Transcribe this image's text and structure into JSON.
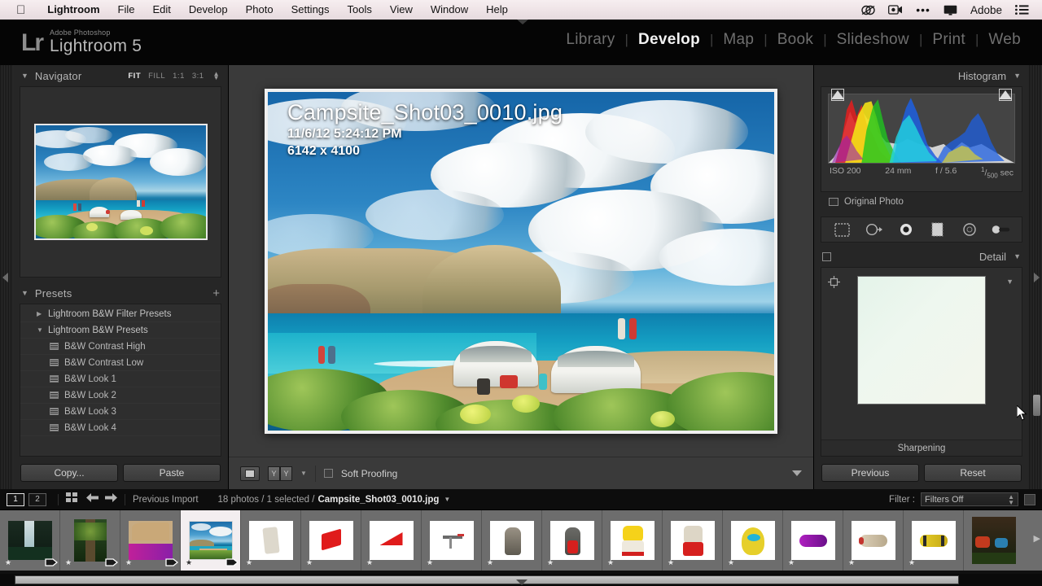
{
  "macmenu": {
    "apple": "apple-logo",
    "items": [
      "Lightroom",
      "File",
      "Edit",
      "Develop",
      "Photo",
      "Settings",
      "Tools",
      "View",
      "Window",
      "Help"
    ],
    "right": {
      "cc_icon": "creative-cloud-icon",
      "rec_icon": "screen-record-icon",
      "dots": "•••",
      "display_icon": "display-icon",
      "label": "Adobe",
      "list_icon": "list-icon"
    }
  },
  "identity": {
    "mark": "Lr",
    "line1": "Adobe Photoshop",
    "line2": "Lightroom 5"
  },
  "modules": [
    {
      "label": "Library",
      "active": false
    },
    {
      "label": "Develop",
      "active": true
    },
    {
      "label": "Map",
      "active": false
    },
    {
      "label": "Book",
      "active": false
    },
    {
      "label": "Slideshow",
      "active": false
    },
    {
      "label": "Print",
      "active": false
    },
    {
      "label": "Web",
      "active": false
    }
  ],
  "navigator": {
    "title": "Navigator",
    "zoom_levels": [
      "FIT",
      "FILL",
      "1:1",
      "3:1"
    ],
    "active_zoom": "FIT"
  },
  "presets": {
    "title": "Presets",
    "add_label": "+",
    "items": [
      {
        "label": "Lightroom B&W Filter Presets",
        "type": "group",
        "expanded": false
      },
      {
        "label": "Lightroom B&W Presets",
        "type": "group",
        "expanded": true
      },
      {
        "label": "B&W Contrast High",
        "type": "preset"
      },
      {
        "label": "B&W Contrast Low",
        "type": "preset"
      },
      {
        "label": "B&W Look 1",
        "type": "preset"
      },
      {
        "label": "B&W Look 2",
        "type": "preset"
      },
      {
        "label": "B&W Look 3",
        "type": "preset"
      },
      {
        "label": "B&W Look 4",
        "type": "preset"
      }
    ]
  },
  "left_buttons": {
    "copy": "Copy...",
    "paste": "Paste"
  },
  "photo_overlay": {
    "filename": "Campsite_Shot03_0010.jpg",
    "datetime": "11/6/12 5:24:12 PM",
    "dimensions": "6142 x 4100"
  },
  "center_toolbar": {
    "loupe_icon": "loupe-view-icon",
    "before_after_left": "Y",
    "before_after_right": "Y",
    "soft_proofing_label": "Soft Proofing",
    "soft_proofing_checked": false,
    "dropdown_icon": "chevron-down-icon"
  },
  "histogram": {
    "title": "Histogram",
    "exif": {
      "iso": "ISO 200",
      "focal": "24 mm",
      "aperture": "f / 5.6",
      "shutter_num": "1",
      "shutter_den": "500",
      "shutter_unit": "sec"
    },
    "original_photo_label": "Original Photo",
    "original_photo_checked": false
  },
  "tools": [
    {
      "name": "crop-overlay-icon"
    },
    {
      "name": "spot-removal-icon"
    },
    {
      "name": "red-eye-correction-icon"
    },
    {
      "name": "graduated-filter-icon"
    },
    {
      "name": "radial-filter-icon"
    },
    {
      "name": "adjustment-brush-icon"
    }
  ],
  "detail": {
    "title": "Detail",
    "target_icon": "target-adjust-icon",
    "collapse_icon": "chevron-down-icon",
    "sharpening_label": "Sharpening"
  },
  "right_buttons": {
    "previous": "Previous",
    "reset": "Reset"
  },
  "filmstrip_bar": {
    "source1": "1",
    "source2": "2",
    "grid_icon": "grid-view-icon",
    "back_icon": "arrow-left-icon",
    "forward_icon": "arrow-right-icon",
    "source_label": "Previous Import",
    "count_label": "18 photos / 1 selected /",
    "selected_file": "Campsite_Shot03_0010.jpg",
    "file_dropdown_icon": "chevron-down-icon",
    "filter_label": "Filter :",
    "filter_value": "Filters Off",
    "filter_toggle_icon": "filter-toggle-icon"
  },
  "thumbnails": [
    {
      "kind": "waterfall",
      "badge": true,
      "star": true,
      "selected": false
    },
    {
      "kind": "forest",
      "badge": true,
      "star": true,
      "selected": false
    },
    {
      "kind": "tent-purple",
      "badge": true,
      "star": true,
      "selected": false
    },
    {
      "kind": "campsite",
      "badge": true,
      "star": true,
      "selected": true
    },
    {
      "kind": "product-mat",
      "badge": false,
      "star": true,
      "selected": false
    },
    {
      "kind": "product-chair-red",
      "badge": false,
      "star": true,
      "selected": false
    },
    {
      "kind": "product-chair-red2",
      "badge": false,
      "star": true,
      "selected": false
    },
    {
      "kind": "product-stove",
      "badge": false,
      "star": true,
      "selected": false
    },
    {
      "kind": "product-pack-gray",
      "badge": false,
      "star": true,
      "selected": false
    },
    {
      "kind": "product-pack-red",
      "badge": false,
      "star": true,
      "selected": false
    },
    {
      "kind": "product-pack-yellow",
      "badge": false,
      "star": true,
      "selected": false
    },
    {
      "kind": "product-pack-white",
      "badge": false,
      "star": true,
      "selected": false
    },
    {
      "kind": "product-bag-yellow",
      "badge": false,
      "star": true,
      "selected": false
    },
    {
      "kind": "product-bag-purple",
      "badge": false,
      "star": true,
      "selected": false
    },
    {
      "kind": "product-bag-cream",
      "badge": false,
      "star": true,
      "selected": false
    },
    {
      "kind": "product-bag-yellow2",
      "badge": false,
      "star": true,
      "selected": false
    },
    {
      "kind": "camp-dark",
      "badge": false,
      "star": false,
      "selected": false
    }
  ],
  "colors": {
    "panel_bg": "#262626",
    "stage_bg": "#3a3a3a",
    "accent_selected": "#f3eef0",
    "text_primary": "#e8e8e8",
    "text_secondary": "#a6a6a6"
  }
}
